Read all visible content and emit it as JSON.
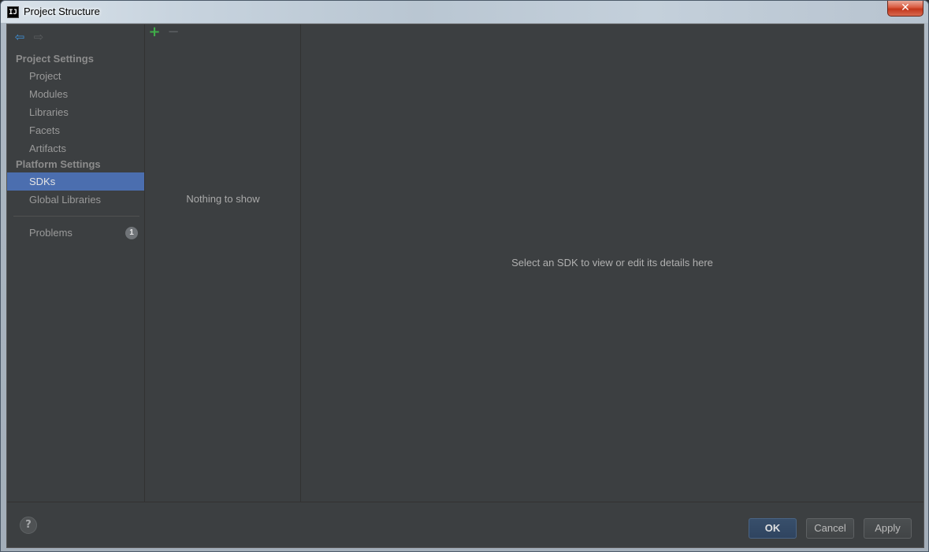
{
  "window": {
    "title": "Project Structure",
    "app_icon_text": "IJ",
    "close_label": "✕"
  },
  "navigation": {
    "back_label": "⇦",
    "forward_label": "⇨"
  },
  "sidebar": {
    "project_settings_title": "Project Settings",
    "project_items": [
      {
        "label": "Project"
      },
      {
        "label": "Modules"
      },
      {
        "label": "Libraries"
      },
      {
        "label": "Facets"
      },
      {
        "label": "Artifacts"
      }
    ],
    "platform_settings_title": "Platform Settings",
    "platform_items": [
      {
        "label": "SDKs",
        "selected": true
      },
      {
        "label": "Global Libraries"
      }
    ],
    "problems": {
      "label": "Problems",
      "count": "1"
    }
  },
  "sdk_list": {
    "add_label": "+",
    "remove_label": "−",
    "empty_text": "Nothing to show"
  },
  "details": {
    "placeholder": "Select an SDK to view or edit its details here"
  },
  "footer": {
    "help_label": "?",
    "ok_label": "OK",
    "cancel_label": "Cancel",
    "apply_label": "Apply"
  },
  "colors": {
    "background": "#3c3f41",
    "selection": "#4b6eaf",
    "add_icon": "#3fae49",
    "back_arrow": "#3e8fd6"
  }
}
